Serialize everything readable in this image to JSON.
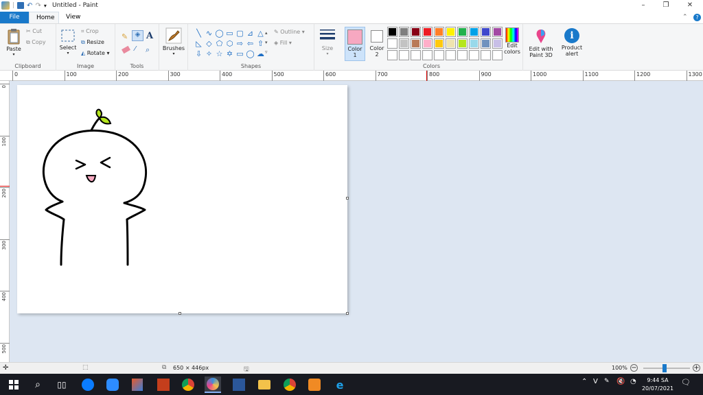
{
  "window": {
    "title": "Untitled - Paint",
    "controls": {
      "minimize": "–",
      "restore": "❐",
      "close": "✕"
    }
  },
  "tabs": [
    {
      "label": "File"
    },
    {
      "label": "Home"
    },
    {
      "label": "View"
    }
  ],
  "ribbon": {
    "clipboard": {
      "label": "Clipboard",
      "paste": "Paste",
      "cut": "Cut",
      "copy": "Copy"
    },
    "image": {
      "label": "Image",
      "select": "Select",
      "crop": "Crop",
      "resize": "Resize",
      "rotate": "Rotate"
    },
    "tools": {
      "label": "Tools"
    },
    "brushes": {
      "label": "Brushes"
    },
    "shapes": {
      "label": "Shapes",
      "outline": "Outline",
      "fill": "Fill"
    },
    "size": {
      "label": "Size"
    },
    "colors": {
      "label": "Colors",
      "color1": "Color",
      "color1_num": "1",
      "color2": "Color",
      "color2_num": "2",
      "color1_value": "#f7a8c1",
      "color2_value": "#ffffff",
      "edit_colors_1": "Edit",
      "edit_colors_2": "colors",
      "palette": [
        "#000000",
        "#7f7f7f",
        "#880015",
        "#ed1c24",
        "#ff7f27",
        "#fff200",
        "#22b14c",
        "#00a2e8",
        "#3f48cc",
        "#a349a4",
        "#ffffff",
        "#c3c3c3",
        "#b97a57",
        "#ffaec9",
        "#ffc90e",
        "#efe4b0",
        "#b5e61d",
        "#99d9ea",
        "#7092be",
        "#c8bfe7",
        "#ffffff",
        "#ffffff",
        "#ffffff",
        "#ffffff",
        "#ffffff",
        "#ffffff",
        "#ffffff",
        "#ffffff",
        "#ffffff",
        "#ffffff"
      ]
    },
    "paint3d": {
      "line1": "Edit with",
      "line2": "Paint 3D"
    },
    "product_alert": {
      "line1": "Product",
      "line2": "alert"
    }
  },
  "ruler_h": [
    "0",
    "100",
    "200",
    "300",
    "400",
    "500",
    "600",
    "700",
    "800",
    "900",
    "1000",
    "1100",
    "1200",
    "1300"
  ],
  "ruler_v": [
    "0",
    "100",
    "200",
    "300",
    "400",
    "500"
  ],
  "status": {
    "dimensions": "650 × 446px",
    "zoom": "100%"
  },
  "taskbar": {
    "apps": [
      "start",
      "search",
      "task-view",
      "zalo",
      "zoom",
      "snip",
      "powerpoint",
      "chrome-alt",
      "paint",
      "word",
      "explorer",
      "chrome",
      "foxit",
      "ie"
    ],
    "clock_time": "9:44 SA",
    "clock_date": "20/07/2021",
    "tray_lang": "V"
  }
}
